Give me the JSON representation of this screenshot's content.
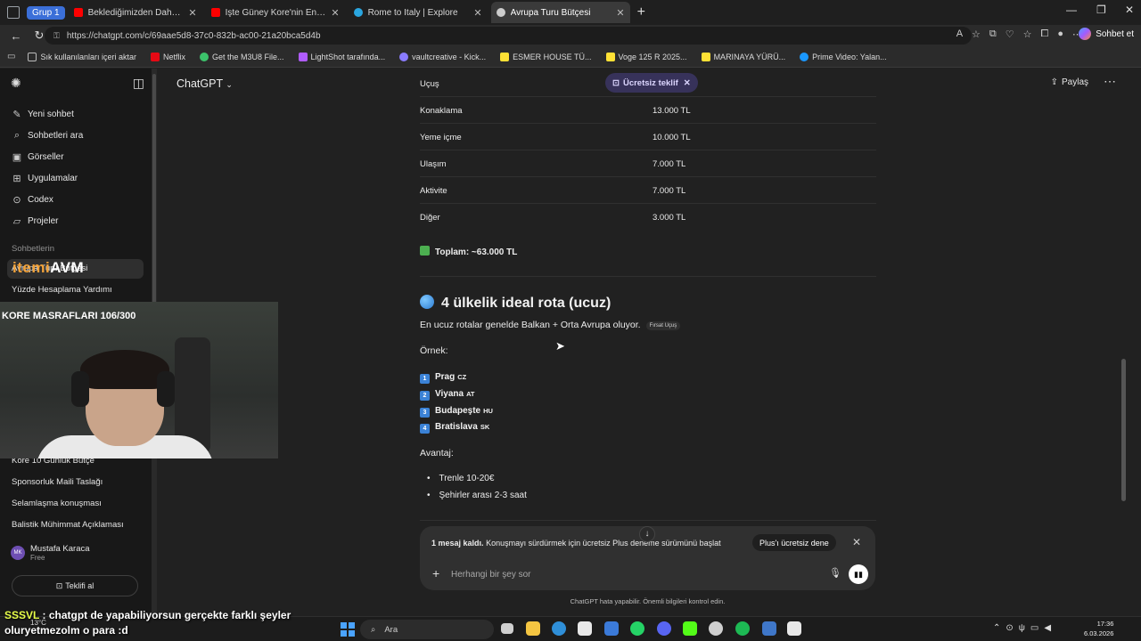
{
  "browser": {
    "group_label": "Grup 1",
    "tabs": [
      {
        "title": "Beklediğimizden Daha Samimi Bir"
      },
      {
        "title": "İşte Güney Kore'nin En Lüks Bölge"
      },
      {
        "title": "Rome to Italy | Explore"
      },
      {
        "title": "Avrupa Turu Bütçesi"
      }
    ],
    "url": "https://chatgpt.com/c/69aae5d8-37c0-832b-ac00-21a20bca5d4b",
    "copilot_label": "Sohbet et",
    "bookmarks": [
      "Sık kullanılanları içeri aktar",
      "Netflix",
      "Get the M3U8 File...",
      "LightShot tarafında...",
      "vaultcreative - Kick...",
      "ESMER HOUSE TÜ...",
      "Voge 125 R 2025...",
      "MARINAYA YÜRÜ...",
      "Prime Video: Yalan..."
    ]
  },
  "sidebar": {
    "nav": [
      {
        "label": "Yeni sohbet"
      },
      {
        "label": "Sohbetleri ara"
      },
      {
        "label": "Görseller"
      },
      {
        "label": "Uygulamalar"
      },
      {
        "label": "Codex"
      },
      {
        "label": "Projeler"
      }
    ],
    "section_label": "Sohbetlerin",
    "conversations": [
      "Avrupa Turu Bütçesi",
      "Yüzde Hesaplama Yardımı",
      "Kore 10 Günlük Bütçe",
      "Sponsorluk Maili Taslağı",
      "Selamlaşma konuşması",
      "Balistik Mühimmat Açıklaması"
    ],
    "user": {
      "initials": "MK",
      "name": "Mustafa Karaca",
      "plan": "Free"
    },
    "upgrade_label": "Teklifi al"
  },
  "header": {
    "model": "ChatGPT",
    "free_offer": "Ücretsiz teklif",
    "share": "Paylaş"
  },
  "budget_table": [
    {
      "label": "Uçuş",
      "value": ""
    },
    {
      "label": "Konaklama",
      "value": "13.000 TL"
    },
    {
      "label": "Yeme içme",
      "value": "10.000 TL"
    },
    {
      "label": "Ulaşım",
      "value": "7.000 TL"
    },
    {
      "label": "Aktivite",
      "value": "7.000 TL"
    },
    {
      "label": "Diğer",
      "value": "3.000 TL"
    }
  ],
  "total": "Toplam: ~63.000 TL",
  "route": {
    "heading": "4 ülkelik ideal rota (ucuz)",
    "intro": "En ucuz rotalar genelde Balkan + Orta Avrupa oluyor.",
    "source_chip": "Fırsat Uçuş",
    "example_label": "Örnek:",
    "cities": [
      {
        "num": "1",
        "name": "Prag",
        "code": "CZ"
      },
      {
        "num": "2",
        "name": "Viyana",
        "code": "AT"
      },
      {
        "num": "3",
        "name": "Budapeşte",
        "code": "HU"
      },
      {
        "num": "4",
        "name": "Bratislava",
        "code": "SK"
      }
    ],
    "advantage_label": "Avantaj:",
    "advantages": [
      "Trenle 10-20€",
      "Şehirler arası 2-3 saat"
    ]
  },
  "limit_banner": {
    "bold": "1 mesaj kaldı.",
    "text": "Konuşmayı sürdürmek için ücretsiz Plus deneme sürümünü başlat",
    "button": "Plus'ı ücretsiz dene"
  },
  "composer": {
    "placeholder": "Herhangi bir şey sor",
    "disclaimer": "ChatGPT hata yapabilir. Önemli bilgileri kontrol edin."
  },
  "stream": {
    "logo_a": "itemi",
    "logo_b": "AVM",
    "cam_title": "KORE MASRAFLARI 106/300",
    "chat_user": "SSSVL",
    "chat_line1": ": chatgpt de yapabiliyorsun gerçekte farklı şeyler",
    "chat_line2": "oluryetmezolm o para :d"
  },
  "taskbar": {
    "temp": "13°C",
    "search": "Ara",
    "time": "17:36",
    "date": "6.03.2026"
  },
  "colors": {
    "background": "#212121",
    "sidebar": "#181818",
    "accent_pill": "#37325a",
    "check_green": "#4caf50",
    "number_blue": "#3b82d6"
  }
}
